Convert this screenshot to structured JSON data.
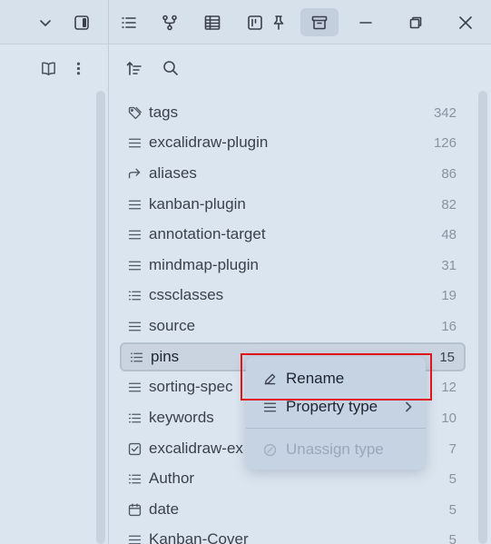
{
  "titlebar": {
    "buttons": [
      {
        "name": "collapse-chevron-icon"
      },
      {
        "name": "sidebar-toggle-icon"
      },
      {
        "name": "list-view-icon"
      },
      {
        "name": "graph-view-icon"
      },
      {
        "name": "table-view-icon"
      },
      {
        "name": "kanban-view-icon"
      },
      {
        "name": "pin-icon"
      },
      {
        "name": "archive-icon"
      },
      {
        "name": "minimize-icon"
      },
      {
        "name": "restore-icon"
      },
      {
        "name": "close-icon"
      }
    ]
  },
  "properties": [
    {
      "name": "tags",
      "count": "342",
      "icon": "tags-icon"
    },
    {
      "name": "excalidraw-plugin",
      "count": "126",
      "icon": "text-icon"
    },
    {
      "name": "aliases",
      "count": "86",
      "icon": "alias-arrow-icon"
    },
    {
      "name": "kanban-plugin",
      "count": "82",
      "icon": "text-icon"
    },
    {
      "name": "annotation-target",
      "count": "48",
      "icon": "text-icon"
    },
    {
      "name": "mindmap-plugin",
      "count": "31",
      "icon": "text-icon"
    },
    {
      "name": "cssclasses",
      "count": "19",
      "icon": "list-icon"
    },
    {
      "name": "source",
      "count": "16",
      "icon": "text-icon"
    },
    {
      "name": "pins",
      "count": "15",
      "icon": "list-icon"
    },
    {
      "name": "sorting-spec",
      "count": "12",
      "icon": "text-icon"
    },
    {
      "name": "keywords",
      "count": "10",
      "icon": "list-icon"
    },
    {
      "name": "excalidraw-ex",
      "count": "7",
      "icon": "checkbox-icon"
    },
    {
      "name": "Author",
      "count": "5",
      "icon": "list-icon"
    },
    {
      "name": "date",
      "count": "5",
      "icon": "calendar-icon"
    },
    {
      "name": "Kanban-Cover",
      "count": "5",
      "icon": "text-icon"
    }
  ],
  "context_menu": {
    "rename": "Rename",
    "property_type": "Property type",
    "unassign_type": "Unassign type"
  }
}
